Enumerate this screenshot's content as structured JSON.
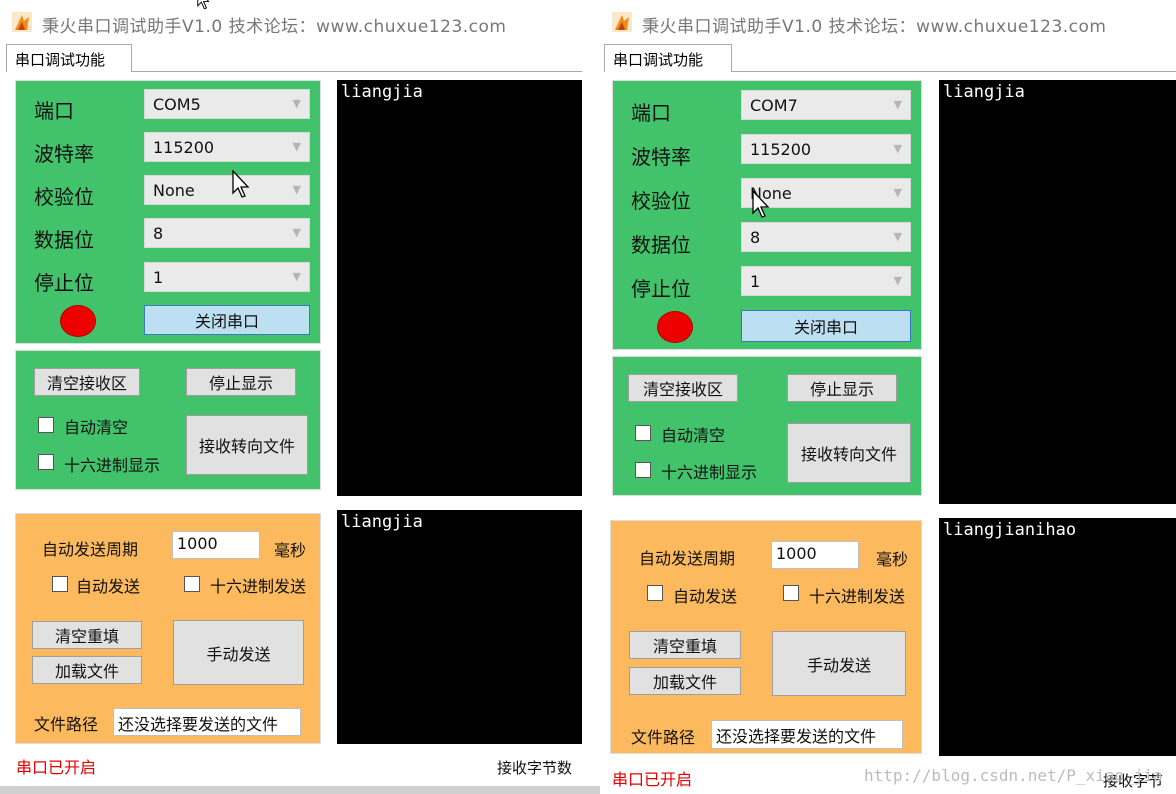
{
  "windows": [
    {
      "title": "秉火串口调试助手V1.0    技术论坛：www.chuxue123.com",
      "tab": "串口调试功能",
      "labels": {
        "port": "端口",
        "baud": "波特率",
        "parity": "校验位",
        "databits": "数据位",
        "stopbits": "停止位"
      },
      "values": {
        "port": "COM5",
        "baud": "115200",
        "parity": "None",
        "databits": "8",
        "stopbits": "1"
      },
      "close_port": "关闭串口",
      "clear_rx": "清空接收区",
      "stop_display": "停止显示",
      "auto_clear": "自动清空",
      "hex_display": "十六进制显示",
      "rx_to_file": "接收转向文件",
      "auto_period_label": "自动发送周期",
      "period_value": "1000",
      "ms": "毫秒",
      "auto_send": "自动发送",
      "hex_send": "十六进制发送",
      "clear_refill": "清空重填",
      "manual_send": "手动发送",
      "load_file": "加载文件",
      "file_path_label": "文件路径",
      "file_path_value": "还没选择要发送的文件",
      "status": "串口已开启",
      "recv_bytes": "接收字节数",
      "rx_text": "liangjia",
      "tx_text": "liangjia"
    },
    {
      "title": "秉火串口调试助手V1.0    技术论坛：www.chuxue123.com",
      "tab": "串口调试功能",
      "labels": {
        "port": "端口",
        "baud": "波特率",
        "parity": "校验位",
        "databits": "数据位",
        "stopbits": "停止位"
      },
      "values": {
        "port": "COM7",
        "baud": "115200",
        "parity": "None",
        "databits": "8",
        "stopbits": "1"
      },
      "close_port": "关闭串口",
      "clear_rx": "清空接收区",
      "stop_display": "停止显示",
      "auto_clear": "自动清空",
      "hex_display": "十六进制显示",
      "rx_to_file": "接收转向文件",
      "auto_period_label": "自动发送周期",
      "period_value": "1000",
      "ms": "毫秒",
      "auto_send": "自动发送",
      "hex_send": "十六进制发送",
      "clear_refill": "清空重填",
      "manual_send": "手动发送",
      "load_file": "加载文件",
      "file_path_label": "文件路径",
      "file_path_value": "还没选择要发送的文件",
      "status": "串口已开启",
      "recv_bytes": "接收字节",
      "rx_text": "liangjia",
      "tx_text": "liangjianihao"
    }
  ],
  "watermark": "http://blog.csdn.net/P_xiao_jia",
  "colors": {
    "config_panel": "#42c26a",
    "send_panel": "#fdb95d",
    "terminal": "#000000",
    "status_text": "#e60000",
    "led": "#ee0000"
  },
  "icons": {
    "app": "flame-app-icon",
    "pointer": "mouse-cursor-icon"
  }
}
